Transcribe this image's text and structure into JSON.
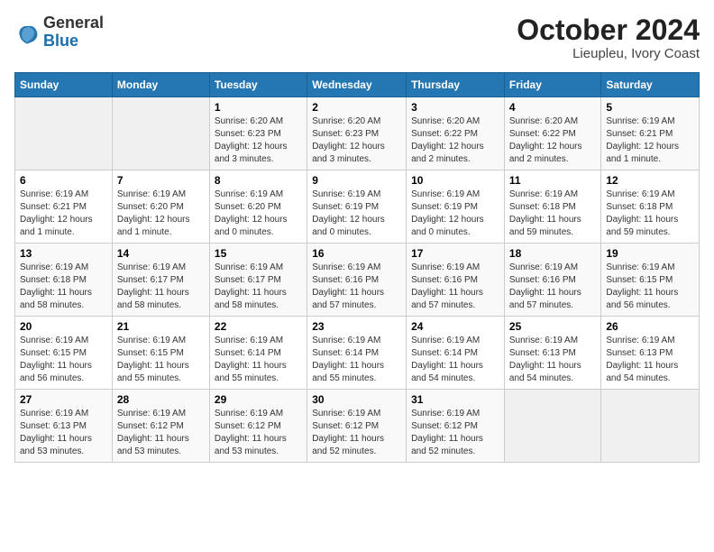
{
  "logo": {
    "general": "General",
    "blue": "Blue"
  },
  "title": "October 2024",
  "location": "Lieupleu, Ivory Coast",
  "header_days": [
    "Sunday",
    "Monday",
    "Tuesday",
    "Wednesday",
    "Thursday",
    "Friday",
    "Saturday"
  ],
  "weeks": [
    [
      {
        "day": "",
        "detail": ""
      },
      {
        "day": "",
        "detail": ""
      },
      {
        "day": "1",
        "detail": "Sunrise: 6:20 AM\nSunset: 6:23 PM\nDaylight: 12 hours and 3 minutes."
      },
      {
        "day": "2",
        "detail": "Sunrise: 6:20 AM\nSunset: 6:23 PM\nDaylight: 12 hours and 3 minutes."
      },
      {
        "day": "3",
        "detail": "Sunrise: 6:20 AM\nSunset: 6:22 PM\nDaylight: 12 hours and 2 minutes."
      },
      {
        "day": "4",
        "detail": "Sunrise: 6:20 AM\nSunset: 6:22 PM\nDaylight: 12 hours and 2 minutes."
      },
      {
        "day": "5",
        "detail": "Sunrise: 6:19 AM\nSunset: 6:21 PM\nDaylight: 12 hours and 1 minute."
      }
    ],
    [
      {
        "day": "6",
        "detail": "Sunrise: 6:19 AM\nSunset: 6:21 PM\nDaylight: 12 hours and 1 minute."
      },
      {
        "day": "7",
        "detail": "Sunrise: 6:19 AM\nSunset: 6:20 PM\nDaylight: 12 hours and 1 minute."
      },
      {
        "day": "8",
        "detail": "Sunrise: 6:19 AM\nSunset: 6:20 PM\nDaylight: 12 hours and 0 minutes."
      },
      {
        "day": "9",
        "detail": "Sunrise: 6:19 AM\nSunset: 6:19 PM\nDaylight: 12 hours and 0 minutes."
      },
      {
        "day": "10",
        "detail": "Sunrise: 6:19 AM\nSunset: 6:19 PM\nDaylight: 12 hours and 0 minutes."
      },
      {
        "day": "11",
        "detail": "Sunrise: 6:19 AM\nSunset: 6:18 PM\nDaylight: 11 hours and 59 minutes."
      },
      {
        "day": "12",
        "detail": "Sunrise: 6:19 AM\nSunset: 6:18 PM\nDaylight: 11 hours and 59 minutes."
      }
    ],
    [
      {
        "day": "13",
        "detail": "Sunrise: 6:19 AM\nSunset: 6:18 PM\nDaylight: 11 hours and 58 minutes."
      },
      {
        "day": "14",
        "detail": "Sunrise: 6:19 AM\nSunset: 6:17 PM\nDaylight: 11 hours and 58 minutes."
      },
      {
        "day": "15",
        "detail": "Sunrise: 6:19 AM\nSunset: 6:17 PM\nDaylight: 11 hours and 58 minutes."
      },
      {
        "day": "16",
        "detail": "Sunrise: 6:19 AM\nSunset: 6:16 PM\nDaylight: 11 hours and 57 minutes."
      },
      {
        "day": "17",
        "detail": "Sunrise: 6:19 AM\nSunset: 6:16 PM\nDaylight: 11 hours and 57 minutes."
      },
      {
        "day": "18",
        "detail": "Sunrise: 6:19 AM\nSunset: 6:16 PM\nDaylight: 11 hours and 57 minutes."
      },
      {
        "day": "19",
        "detail": "Sunrise: 6:19 AM\nSunset: 6:15 PM\nDaylight: 11 hours and 56 minutes."
      }
    ],
    [
      {
        "day": "20",
        "detail": "Sunrise: 6:19 AM\nSunset: 6:15 PM\nDaylight: 11 hours and 56 minutes."
      },
      {
        "day": "21",
        "detail": "Sunrise: 6:19 AM\nSunset: 6:15 PM\nDaylight: 11 hours and 55 minutes."
      },
      {
        "day": "22",
        "detail": "Sunrise: 6:19 AM\nSunset: 6:14 PM\nDaylight: 11 hours and 55 minutes."
      },
      {
        "day": "23",
        "detail": "Sunrise: 6:19 AM\nSunset: 6:14 PM\nDaylight: 11 hours and 55 minutes."
      },
      {
        "day": "24",
        "detail": "Sunrise: 6:19 AM\nSunset: 6:14 PM\nDaylight: 11 hours and 54 minutes."
      },
      {
        "day": "25",
        "detail": "Sunrise: 6:19 AM\nSunset: 6:13 PM\nDaylight: 11 hours and 54 minutes."
      },
      {
        "day": "26",
        "detail": "Sunrise: 6:19 AM\nSunset: 6:13 PM\nDaylight: 11 hours and 54 minutes."
      }
    ],
    [
      {
        "day": "27",
        "detail": "Sunrise: 6:19 AM\nSunset: 6:13 PM\nDaylight: 11 hours and 53 minutes."
      },
      {
        "day": "28",
        "detail": "Sunrise: 6:19 AM\nSunset: 6:12 PM\nDaylight: 11 hours and 53 minutes."
      },
      {
        "day": "29",
        "detail": "Sunrise: 6:19 AM\nSunset: 6:12 PM\nDaylight: 11 hours and 53 minutes."
      },
      {
        "day": "30",
        "detail": "Sunrise: 6:19 AM\nSunset: 6:12 PM\nDaylight: 11 hours and 52 minutes."
      },
      {
        "day": "31",
        "detail": "Sunrise: 6:19 AM\nSunset: 6:12 PM\nDaylight: 11 hours and 52 minutes."
      },
      {
        "day": "",
        "detail": ""
      },
      {
        "day": "",
        "detail": ""
      }
    ]
  ]
}
